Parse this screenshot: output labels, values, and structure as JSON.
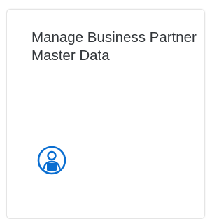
{
  "tile": {
    "title": "Manage Business Partner Master Data",
    "icon": "business-partner-icon",
    "accent_color": "#0a6ed1",
    "text_color": "#32363a"
  }
}
